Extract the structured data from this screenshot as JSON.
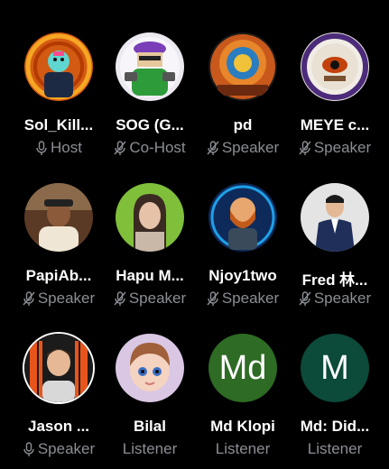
{
  "participants": [
    {
      "name": "Sol_Kill...",
      "role": "Host",
      "mic": "mic-icon",
      "avatar": "robot-character-avatar"
    },
    {
      "name": "SOG (G...",
      "role": "Co-Host",
      "mic": "mic-muted-icon",
      "avatar": "soldier-character-avatar"
    },
    {
      "name": "pd",
      "role": "Speaker",
      "mic": "mic-muted-icon",
      "avatar": "emblem-avatar"
    },
    {
      "name": "MEYE c...",
      "role": "Speaker",
      "mic": "mic-muted-icon",
      "avatar": "seal-avatar"
    },
    {
      "name": "PapiAb...",
      "role": "Speaker",
      "mic": "mic-muted-icon",
      "avatar": "man-cap-avatar"
    },
    {
      "name": "Hapu M...",
      "role": "Speaker",
      "mic": "mic-muted-icon",
      "avatar": "woman-photo-avatar"
    },
    {
      "name": "Njoy1two",
      "role": "Speaker",
      "mic": "mic-muted-icon",
      "avatar": "bearded-figure-avatar"
    },
    {
      "name": "Fred 林...",
      "role": "Speaker",
      "mic": "mic-muted-icon",
      "avatar": "man-suit-avatar"
    },
    {
      "name": "Jason ...",
      "role": "Speaker",
      "mic": "mic-icon",
      "avatar": "smiling-man-avatar"
    },
    {
      "name": "Bilal",
      "role": "Listener",
      "avatar": "child-illustration-avatar"
    },
    {
      "name": "Md Klopi",
      "role": "Listener",
      "avatar_initials": "Md",
      "avatar_color": "#2e6b24"
    },
    {
      "name": "Md: Did...",
      "role": "Listener",
      "avatar_initials": "M",
      "avatar_color": "#0c4a3a"
    }
  ],
  "colors": {
    "background": "#000000",
    "role_text": "#8b8e94",
    "name_text": "#ffffff"
  }
}
